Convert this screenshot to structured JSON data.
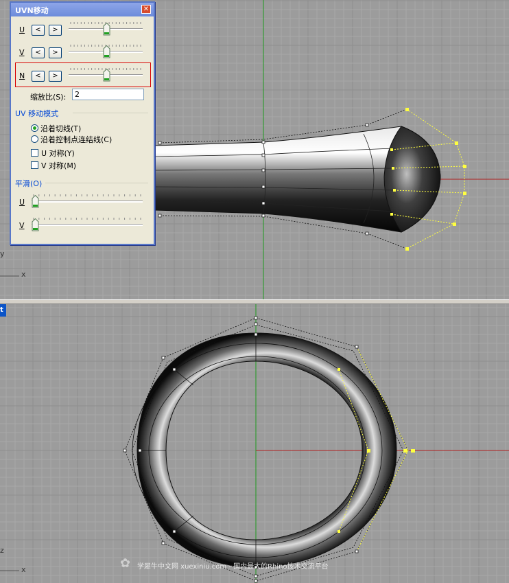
{
  "dialog": {
    "title": "UVN移动",
    "close_symbol": "✕",
    "rows": [
      {
        "label": "U",
        "prev_label": "<",
        "next_label": ">",
        "value": 0.52
      },
      {
        "label": "V",
        "prev_label": "<",
        "next_label": ">",
        "value": 0.52
      },
      {
        "label": "N",
        "prev_label": "<",
        "next_label": ">",
        "value": 0.52
      }
    ],
    "scale_label": "缩放比(S):",
    "scale_value": "2",
    "mode_group_title": "UV 移动模式",
    "mode_options": [
      {
        "label": "沿着切线(T)",
        "selected": true
      },
      {
        "label": "沿着控制点连结线(C)",
        "selected": false
      }
    ],
    "symmetry_options": [
      {
        "label": "U 对称(Y)",
        "checked": false
      },
      {
        "label": "V 对称(M)",
        "checked": false
      }
    ],
    "smooth_group_title": "平滑(O)",
    "smooth_rows": [
      {
        "label": "U",
        "value": 0.0
      },
      {
        "label": "V",
        "value": 0.0
      }
    ]
  },
  "viewports": {
    "top_axis_letters": [
      "y",
      "x"
    ],
    "bottom_axis_letters": [
      "z",
      "x"
    ],
    "bottom_tab_label": "t"
  },
  "watermark": {
    "text": "学犀牛中文网 xuexiniu.com - 国内最大的Rhino技术交流平台"
  },
  "colors": {
    "viewport_bg": "#9c9c9c",
    "grid_minor": "#a8a8a8",
    "grid_major": "#8e8e8e",
    "x_axis": "#b02020",
    "y_axis": "#1e9a1e",
    "control_point": "#ffff40",
    "highlight_box": "#d80000"
  }
}
